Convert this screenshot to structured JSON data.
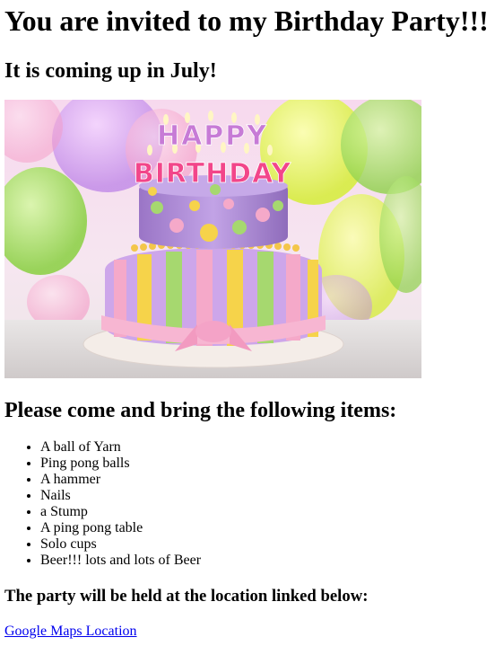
{
  "heading": "You are invited to my Birthday Party!!!",
  "subheading": "It is coming up in July!",
  "image": {
    "topper_line1": "HAPPY",
    "topper_line2": "BIRTHDAY",
    "colors": {
      "frosting_top": "#b592d6",
      "frosting_bottom": "#c9a5e6",
      "stripe_yellow": "#f6d34a",
      "stripe_green": "#9fd36a",
      "stripe_pink": "#f5a9c9",
      "ribbon": "#f7b6d2",
      "plate": "#f3ece6"
    }
  },
  "items_title": "Please come and bring the following items:",
  "items": [
    "A ball of Yarn",
    "Ping pong balls",
    "A hammer",
    "Nails",
    "a Stump",
    "A ping pong table",
    "Solo cups",
    "Beer!!! lots and lots of Beer"
  ],
  "location_note": "The party will be held at the location linked below:",
  "map_link": "Google Maps Location"
}
